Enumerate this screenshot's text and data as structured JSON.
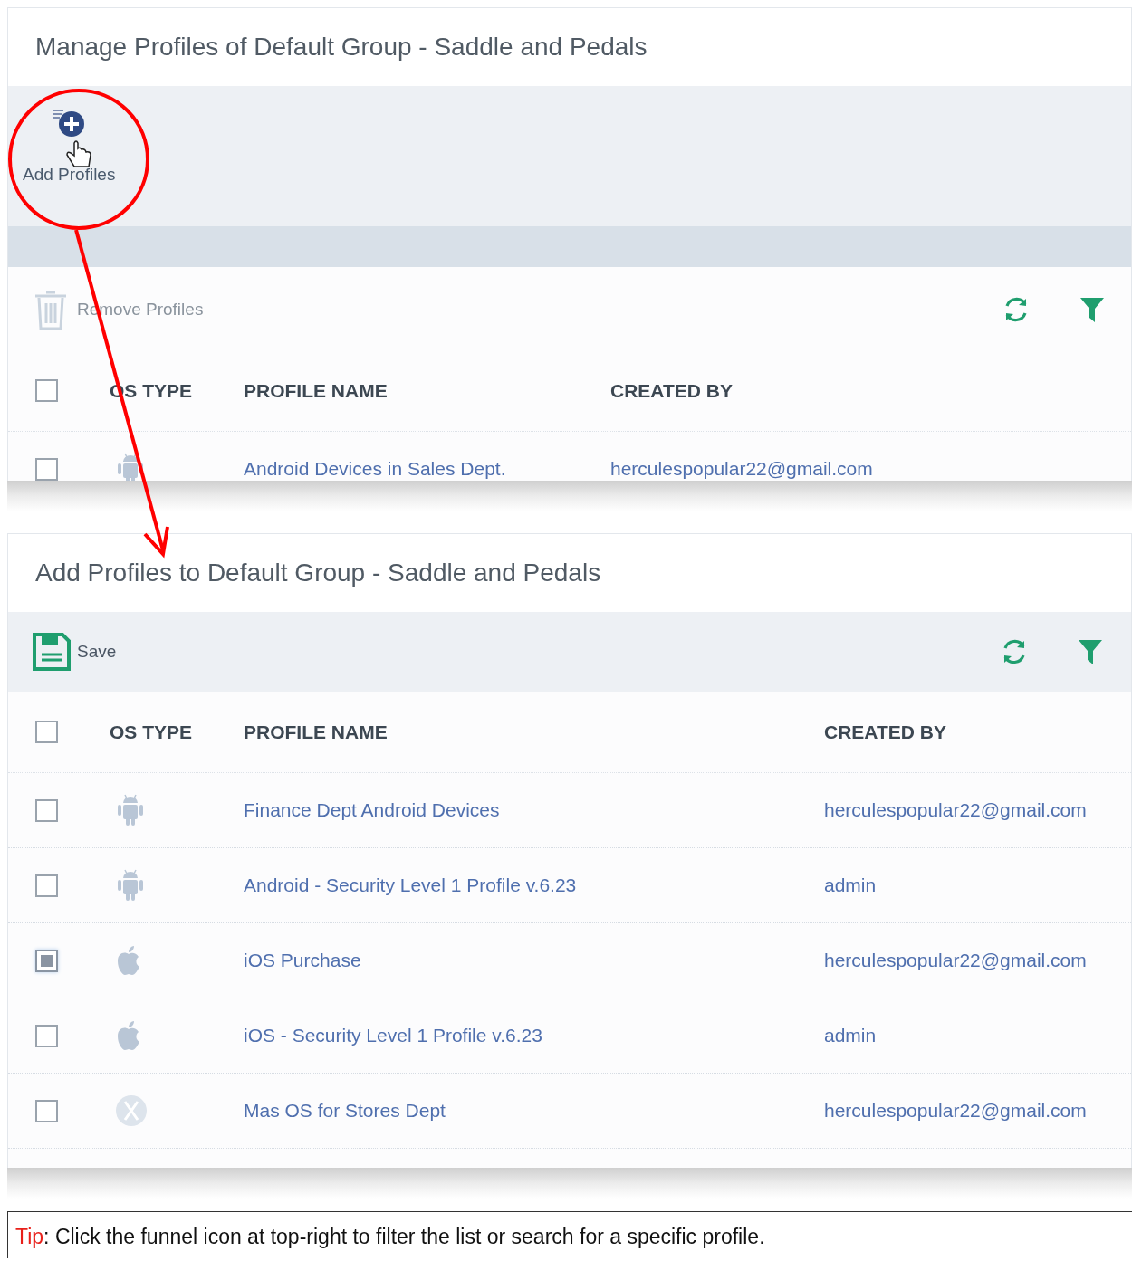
{
  "manage_panel": {
    "title": "Manage Profiles of Default Group - Saddle and Pedals",
    "add_button": "Add Profiles",
    "remove_button": "Remove Profiles",
    "columns": [
      "OS TYPE",
      "PROFILE NAME",
      "CREATED BY"
    ],
    "header_checked": false,
    "rows": [
      {
        "kind": "android",
        "name": "Android Devices in Sales Dept.",
        "created_by": "herculespopular22@gmail.com",
        "checked": false
      }
    ]
  },
  "add_panel": {
    "title": "Add Profiles to Default Group - Saddle and Pedals",
    "save_button": "Save",
    "columns": [
      "OS TYPE",
      "PROFILE NAME",
      "CREATED BY"
    ],
    "header_checked": false,
    "rows": [
      {
        "kind": "android",
        "name": "Finance Dept Android Devices",
        "created_by": "herculespopular22@gmail.com",
        "checked": false
      },
      {
        "kind": "android",
        "name": "Android - Security Level 1 Profile v.6.23",
        "created_by": "admin",
        "checked": false
      },
      {
        "kind": "ios",
        "name": "iOS Purchase",
        "created_by": "herculespopular22@gmail.com",
        "checked": true
      },
      {
        "kind": "ios",
        "name": "iOS - Security Level 1 Profile v.6.23",
        "created_by": "admin",
        "checked": false
      },
      {
        "kind": "macos",
        "name": "Mas OS for Stores Dept",
        "created_by": "herculespopular22@gmail.com",
        "checked": false
      }
    ]
  },
  "tip": "**Tip**: Click the funnel icon at top-right to filter the list or search for a specific profile."
}
